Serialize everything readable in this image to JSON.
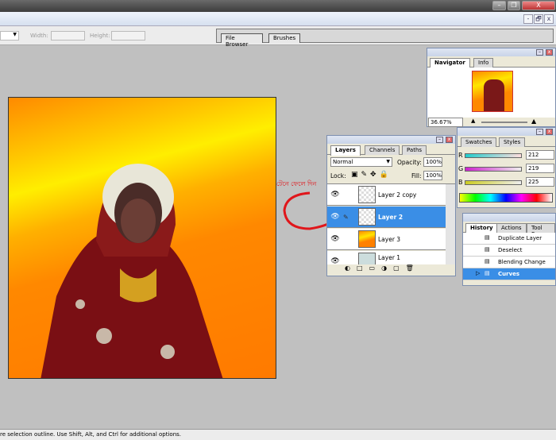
{
  "window": {
    "minimize": "–",
    "restore": "❐",
    "close": "X"
  },
  "doc_controls": {
    "minimize": "-",
    "restore": "🗗",
    "close": "x"
  },
  "options": {
    "width_label": "Width:",
    "height_label": "Height:"
  },
  "well_tabs": [
    "File Browser",
    "Brushes"
  ],
  "annotation": {
    "text": "টেনে ফেলে দিন",
    "color": "#e0161b"
  },
  "navigator": {
    "tabs": [
      "Navigator",
      "Info"
    ],
    "zoom": "36.67%"
  },
  "color": {
    "tabs": [
      "Swatches",
      "Styles"
    ],
    "r": "212",
    "g": "219",
    "b": "225",
    "r_label": "R",
    "g_label": "G",
    "b_label": "B"
  },
  "layers": {
    "tabs": [
      "Layers",
      "Channels",
      "Paths"
    ],
    "blend_mode": "Normal",
    "opacity_label": "Opacity:",
    "opacity": "100%",
    "lock_label": "Lock:",
    "fill_label": "Fill:",
    "fill": "100%",
    "items": [
      {
        "name": "Layer 2 copy"
      },
      {
        "name": "Layer 2",
        "selected": true
      },
      {
        "name": "Layer 3"
      },
      {
        "name": "Layer 1"
      }
    ]
  },
  "history": {
    "tabs": [
      "History",
      "Actions",
      "Tool Pres"
    ],
    "items": [
      "Duplicate Layer",
      "Deselect",
      "Blending Change",
      "Curves"
    ],
    "selected": "Curves"
  },
  "status": "re selection outline.  Use Shift, Alt, and Ctrl for additional options.",
  "colors": {
    "selection": "#3a8ee6"
  }
}
